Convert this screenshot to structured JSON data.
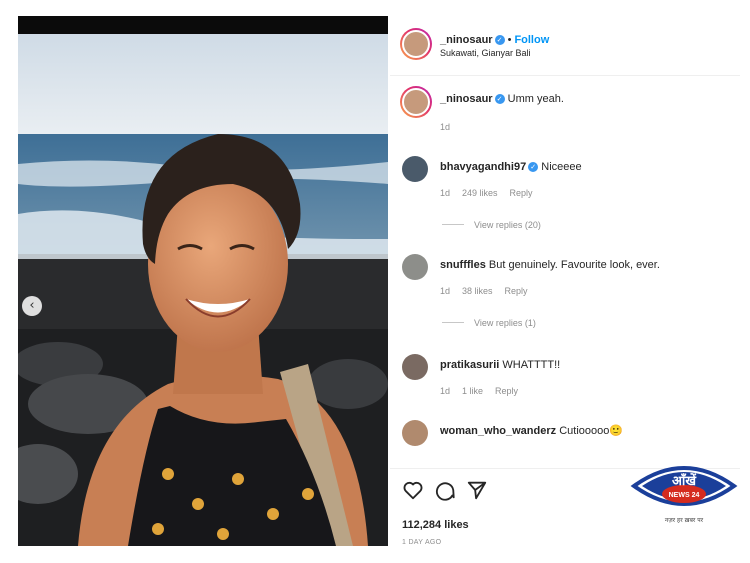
{
  "post": {
    "author": "_ninosaur",
    "follow_label": "Follow",
    "dot": "•",
    "location": "Sukawati, Gianyar Bali"
  },
  "caption": {
    "user": "_ninosaur",
    "text": "Umm yeah.",
    "time": "1d"
  },
  "comments": [
    {
      "user": "bhavyagandhi97",
      "verified": true,
      "text": "Niceeee",
      "time": "1d",
      "likes": "249 likes",
      "reply": "Reply",
      "view_replies": "View replies (20)"
    },
    {
      "user": "snufffles",
      "verified": false,
      "text": "But genuinely. Favourite look, ever.",
      "time": "1d",
      "likes": "38 likes",
      "reply": "Reply",
      "view_replies": "View replies (1)"
    },
    {
      "user": "pratikasurii",
      "verified": false,
      "text": "WHATTTT!!",
      "time": "1d",
      "likes": "1 like",
      "reply": "Reply"
    },
    {
      "user": "woman_who_wanderz",
      "verified": false,
      "text": "Cutiooooo🙂"
    }
  ],
  "actions": {
    "like_icon": "heart-icon",
    "comment_icon": "comment-icon",
    "share_icon": "paper-plane-icon"
  },
  "likes_count": "112,284 likes",
  "posted_ago": "1 DAY AGO",
  "watermark": {
    "brand_top": "आँखें",
    "brand_bottom": "NEWS 24",
    "tagline": "नज़र हर ख़बर पर"
  },
  "colors": {
    "link_blue": "#0095f6",
    "verified_blue": "#3897f0",
    "muted_text": "#8e8e8e",
    "logo_blue": "#1b3f9a",
    "logo_red": "#d52b1e"
  }
}
